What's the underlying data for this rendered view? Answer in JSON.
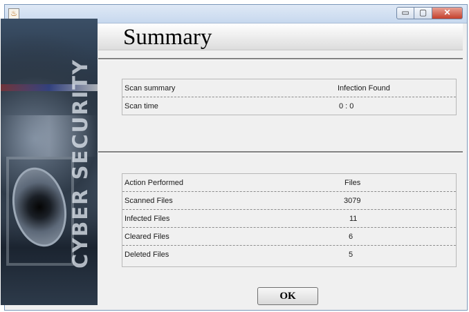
{
  "window": {
    "title_bar_icon": "java-cup-icon",
    "controls": {
      "minimize": "▭",
      "maximize": "▢",
      "close": "✕"
    }
  },
  "banner": {
    "text": "CYBER SECURITY"
  },
  "header": {
    "title": "Summary"
  },
  "scan_table": {
    "rows": [
      {
        "label": "Scan summary",
        "value": "Infection Found"
      },
      {
        "label": "Scan time",
        "value": "0 : 0"
      }
    ]
  },
  "action_table": {
    "rows": [
      {
        "label": "Action Performed",
        "value": "Files"
      },
      {
        "label": "Scanned Files",
        "value": "3079"
      },
      {
        "label": "Infected Files",
        "value": "11"
      },
      {
        "label": "Cleared Files",
        "value": "6"
      },
      {
        "label": "Deleted Files",
        "value": "5"
      }
    ]
  },
  "footer": {
    "ok_label": "OK"
  }
}
